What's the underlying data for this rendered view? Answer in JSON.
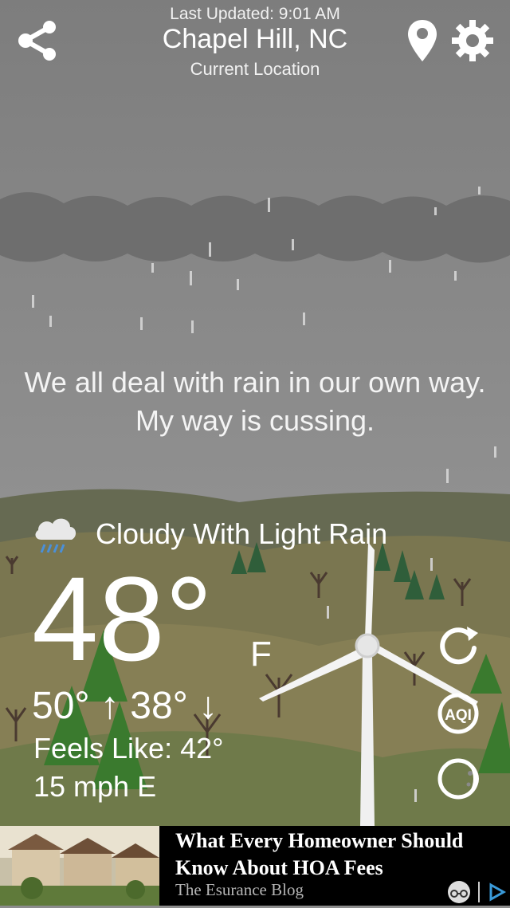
{
  "header": {
    "last_updated": "Last Updated: 9:01 AM",
    "city": "Chapel Hill, NC",
    "location_label": "Current Location"
  },
  "quote": "We all deal with rain in our own way. My way is cussing.",
  "weather": {
    "condition": "Cloudy With Light Rain",
    "temperature": "48°",
    "unit": "F",
    "high_low": "50° ↑  38° ↓",
    "feels_like": "Feels Like: 42°",
    "wind": "15 mph E"
  },
  "icons": {
    "share": "share-icon",
    "location": "location-pin-icon",
    "settings": "gear-icon",
    "refresh": "refresh-icon",
    "aqi": "aqi-icon",
    "moon": "moon-icon",
    "condition": "rain-cloud-icon"
  },
  "side_buttons": {
    "aqi_label": "AQI"
  },
  "ad": {
    "title": "What Every Homeowner Should Know About HOA Fees",
    "source": "The Esurance Blog"
  },
  "colors": {
    "sky": "#8a8a8a",
    "hills": "#7f7a4f",
    "trees": "#2e5a2c",
    "ad_background": "#000000"
  }
}
